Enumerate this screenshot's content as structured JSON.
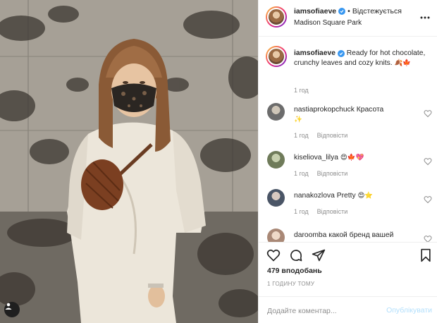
{
  "post": {
    "username": "iamsofiaeve",
    "follow_status": "Відстежується",
    "location": "Madison Square Park",
    "caption": {
      "text": "Ready for hot chocolate, crunchy leaves and cozy knits.",
      "emoji": "🍂🍁",
      "time": "1 год"
    }
  },
  "comments": [
    {
      "user": "nastiaprokopchuck",
      "text": "Красота",
      "emoji": "✨",
      "time": "1 год",
      "reply": "Відповісти"
    },
    {
      "user": "kiseliova_lilya",
      "text": "",
      "emoji": "😍🍁💖",
      "time": "1 год",
      "reply": "Відповісти"
    },
    {
      "user": "nanakozlova",
      "text": "Pretty",
      "emoji": "😍⭐",
      "time": "1 год",
      "reply": "Відповісти"
    },
    {
      "user": "daroomba",
      "text": "какой бренд вашей",
      "emoji": "",
      "time": "",
      "reply": ""
    }
  ],
  "actions": {
    "likes": "479 вподобань",
    "time_ago": "1 ГОДИНУ ТОМУ"
  },
  "composer": {
    "placeholder": "Додайте коментар...",
    "publish_label": "Опублікувати"
  },
  "icons": {
    "like": "heart-icon",
    "comment": "comment-icon",
    "share": "paper-plane-icon",
    "save": "bookmark-icon",
    "more": "more-icon",
    "verified": "verified-badge-icon",
    "tag": "user-tag-icon"
  },
  "colors": {
    "verified": "#3897f0",
    "muted_text": "#8e8e8e",
    "publish_disabled": "#b2dffc",
    "border": "#efefef"
  }
}
